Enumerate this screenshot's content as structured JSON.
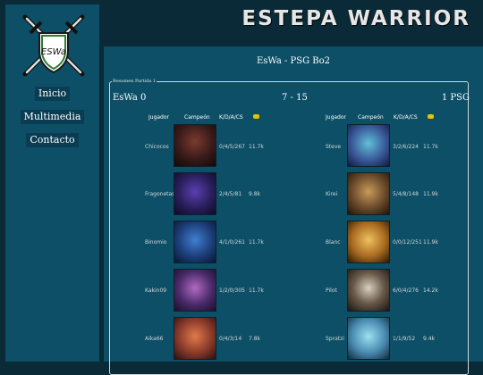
{
  "header": {
    "title": "ESTEPA WARRIOR"
  },
  "sidebar": {
    "logo_text": "ESWa",
    "nav": [
      {
        "label": "Inicio"
      },
      {
        "label": "Multimedia"
      },
      {
        "label": "Contacto"
      }
    ]
  },
  "match": {
    "title": "EsWa - PSG Bo2",
    "legend": "Resumen Partida 1",
    "team_left": "EsWa 0",
    "score": "7 - 15",
    "team_right": "1 PSG",
    "headers": {
      "player": "Jugador",
      "champion": "Campeón",
      "kda": "K/D/A/CS",
      "gold_icon": "gold-coin-icon"
    },
    "left_players": [
      {
        "name": "Chicocos",
        "kda": "0/4/5/267",
        "gold": "11.7k"
      },
      {
        "name": "Fragonetas",
        "kda": "2/4/5/81",
        "gold": "9.8k"
      },
      {
        "name": "Binomio",
        "kda": "4/1/0/261",
        "gold": "11.7k"
      },
      {
        "name": "Kakin09",
        "kda": "1/2/0/305",
        "gold": "11.7k"
      },
      {
        "name": "Aika66",
        "kda": "0/4/3/14",
        "gold": "7.8k"
      }
    ],
    "right_players": [
      {
        "name": "Steve",
        "kda": "3/2/6/224",
        "gold": "11.7k"
      },
      {
        "name": "Kirei",
        "kda": "5/4/8/148",
        "gold": "11.9k"
      },
      {
        "name": "Blanc",
        "kda": "0/0/12/251",
        "gold": "11.9k"
      },
      {
        "name": "Pilot",
        "kda": "6/0/4/276",
        "gold": "14.2k"
      },
      {
        "name": "Spratzi",
        "kda": "1/1/9/52",
        "gold": "9.4k"
      }
    ]
  },
  "colors": {
    "panel": "#0d4f66",
    "background": "#0b2a38",
    "accent": "#e6c200"
  }
}
